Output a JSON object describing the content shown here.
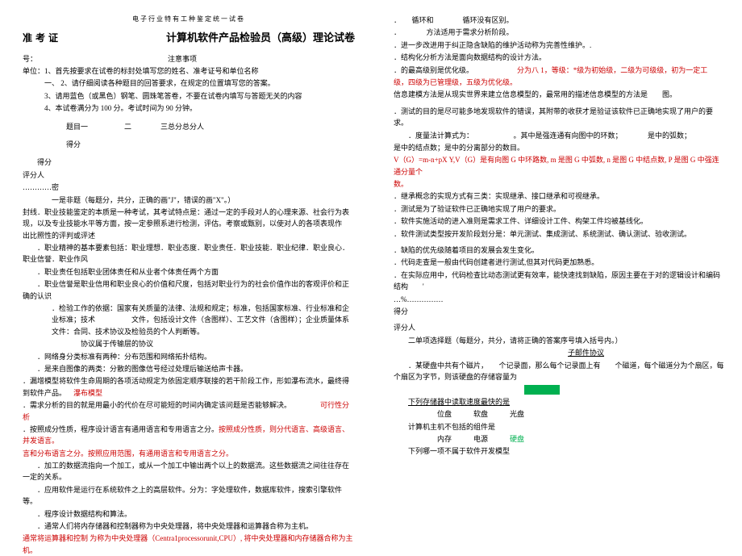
{
  "left": {
    "header": "电子行业特有工种鉴定统一试卷",
    "zkz": "准考证",
    "title": "计算机软件产品检验员（高级）理论试卷",
    "hao": "号：",
    "notice": "注意事项",
    "unit": "单位：1、首先按要求在试卷的标封处填写您的姓名、准考证号和单位名称",
    "i1": "一、 2、请仔细阅读各种题目的回答要求，在规定的位置填写您的答案。",
    "i2": "3、请用蓝色（或黑色）钢笔、圆珠笔答卷，不要在试卷内填写与答题无关的内容",
    "i3": "4、本试卷满分为 100 分。考试时间为 90 分钟。",
    "trow": "题目一　　　　　二　　　　三总分总分人",
    "score": "得分",
    "scorer": "评分人",
    "sealine": "…………密",
    "q1a": "一是非题（每题分，共分，正确的画\"J\"，错误的画\"X\"。）",
    "q1b": "封线．职业技能鉴定的本质是一种考试，其考试特点是：通过一定的手段对人的心理来源、社会行为表现，以及专业技能水平等方面，按一定参照系进行检测，评估。考察或甄别，以使对人的各项表现作　　出比照性的评判或评述",
    "q1c": "．职业精神的基本要素包括：职业理想．职业态度．职业责任．职业技能．职业纪律．职业良心．职业信誉．职业作风",
    "q1d": "．职业责任包括职业团体责任和从业者个体责任两个方面",
    "q1e": "．职业信誉是职业信用和职业良心的价值和尺度，包括对职业行为的社会价值作出的客观评价和正确的认识",
    "q1f": "．检验工作的依据：国家有关质量的法律、法规和规定；标准，包括国家标准、行业标准和企业标准；技术　　　　　文件，包括设计文件（含图样）、工艺文件（含图样）；企业质量体系文件：合同、技术协议及检验员的个人判断等。",
    "q1g": "协议属于传输层的协议",
    "q1h": "．网络身分类标准有两种：分布范围和网络拓扑结构。",
    "q1i": "．是来自图像的两类：分散的图像信号经过处理后输送给声卡器。",
    "q1j": "．漏增模型将软件生命周期的各项活动规定为依固定顺序联接的若干阶段工作，形如瀑布流水，最终得到软件产品。",
    "q1j_red": "瀑布模型",
    "q1k": "．需求分析的目的就是用最小的代价在尽可能短的时间内确定该问题是否能够解决。",
    "q1k_red": "可行性分析",
    "q1l": "．按照成分性质，程序设计语言有通用语言和专用语言之分。",
    "q1l_red": "按照成分性质，则分代语言、高级语言、并发语言。",
    "q1l_red2": "言和分布语言之分。按照应用范围，有通用语言和专用语言之分。",
    "q1m": "　　．加工的数据流指向一个加工，或从一个加工中输出两个以上的数据流。这些数据流之间往往存在一定的关系。",
    "q1n": "．应用软件是运行在系统软件之上的高层软件。分为：字处理软件，数据库软件，搜索引擎软件等。",
    "q1o": "．程序设计数据结构和算法。",
    "q1p": "．通常人们将内存储器和控制器称为中央处理器，将中央处理器和运算器合称为主机。",
    "q1p_red": "通常将运算器和控制 为称为中央处理器（Centra1processorunit,CPU）, 将中央处理器和内存储器合称为主机。"
  },
  "right": {
    "r1": "．　　循环和　　　　循环没有区别。",
    "r2": "．　　　　方法适用于需求分析阶段。",
    "r3": "．进一步改进用于纠正隐含缺陷的维护活动称为完善性维护。.",
    "r4": "．结构化分析方法是面向数据结构的设计方法。",
    "r5": "．的最高级别是优化级。",
    "r5_red": "分为八 1，等级：*级为初始级，二级为可级级，初为一定工",
    "r5_red2": "级，四级为已管理级，五级为优化级。",
    "r6": "信息建模方法是从现实世界来建立信息模型的，最常用的描述信息模型的方法是　　图。",
    "r7": "．测试的目的是尽可能多地发现软件的错误，其附带的收获才是验证该软件已正确地实现了用户的要求。",
    "r8": "．度量法计算式为：　　　　　　。其中是强连通有向图中的环数；　　　　是中的弧数；",
    "r9": "是中的结点数；是中的分离部分的数目。",
    "r9_red": "V（G）=m-n+pX Y,V（G）是有向图 G 中环路数, m 是图 G 中弧数, n 是图 G 中结点数, P 是图 G 中强连通分量个",
    "r9_red2": "数。",
    "r10": "．继承概念的实现方式有三类：实现继承、接口继承和可视继承。",
    "r11": "．测试是为了验证软件已正确地实现了用户的要求。",
    "r12": "．软件实施活动的进入准则是需求工件、详细设计工件、构架工件均被基线化。",
    "r13": "．软件测试类型按开发阶段划分是：单元测试、集成测试、系统测试、确认测试、验收测试。",
    "r14": "．缺陷的优先级随着项目的发展会发生变化。",
    "r15": "．代码走查是一般由代码创建者进行测试,但其对代码更加熟悉。",
    "r16": "．在实际应用中，代码检查比动态测试更有效率，能快速找到缺陷，原因主要在于对的逻辑设计和编码结构　　'",
    "sep": "…%……………",
    "score": "得分",
    "scorer": "评分人",
    "q2": "二单项选择题（每题分，共分，请将正确的答案序号填入括号内。）",
    "q2_1a": "子邮件协议",
    "q2_2": "．某硬盘中共有个磁片，　　个记录面，那么每个记录面上有　　个磁道，每个磁道分为个扇区，每个扇区为字节，则该硬盘的存储容量为",
    "q2_3": "下列存储器中读取速度最快的是",
    "q2_3o": "位盘　　　软盘　　　光盘",
    "q2_4": "计算机主机不包括的组件是",
    "q2_4o": "内存　　　电源",
    "q2_4g": "硬盘",
    "q2_5": "下列哪一项不属于软件开发模型"
  }
}
